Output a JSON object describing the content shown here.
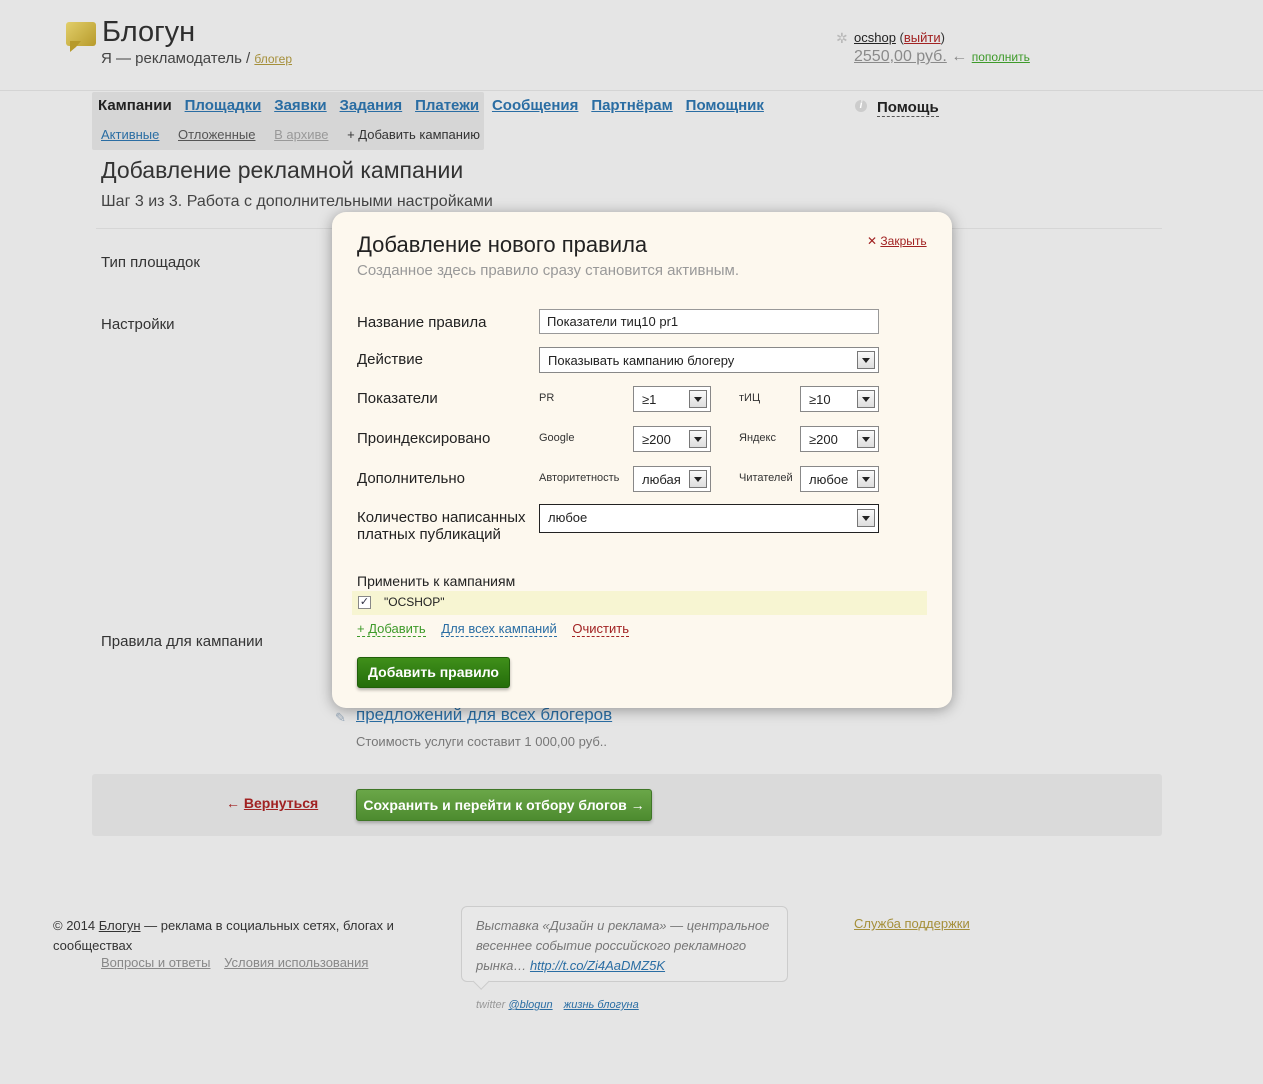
{
  "header": {
    "logo_text": "Блогун",
    "role_prefix": "Я — рекламодатель /",
    "role_link": "блогер",
    "username": "ocshop",
    "logout_label": "выйти",
    "balance": "2550,00 руб.",
    "topup_label": "пополнить"
  },
  "nav": {
    "items": [
      "Кампании",
      "Площадки",
      "Заявки",
      "Задания",
      "Платежи",
      "Сообщения",
      "Партнёрам",
      "Помощник"
    ],
    "sub_items": [
      "Активные",
      "Отложенные",
      "В архиве",
      "+ Добавить кампанию"
    ],
    "help_label": "Помощь"
  },
  "page": {
    "title": "Добавление рекламной кампании",
    "step": "Шаг 3 из 3. Работа с дополнительными настройками",
    "label_site_type": "Тип площадок",
    "label_settings": "Настройки",
    "label_rules": "Правила для кампании",
    "all_bloggers_link": "предложений для всех блогеров",
    "cost_text": "Стоимость услуги составит 1 000,00 руб..",
    "back_label": "Вернуться",
    "save_label": "Сохранить и перейти к отбору блогов →"
  },
  "modal": {
    "title": "Добавление нового правила",
    "subtitle": "Созданное здесь правило сразу становится активным.",
    "close_label": "Закрыть",
    "rule_name_label": "Название правила",
    "rule_name_value": "Показатели тиц10 pr1",
    "action_label": "Действие",
    "action_value": "Показывать кампанию блогеру",
    "metrics_label": "Показатели",
    "pr_label": "PR",
    "pr_value": "≥1",
    "tic_label": "тИЦ",
    "tic_value": "≥10",
    "indexed_label": "Проиндексировано",
    "google_label": "Google",
    "google_value": "≥200",
    "yandex_label": "Яндекс",
    "yandex_value": "≥200",
    "extra_label": "Дополнительно",
    "authority_label": "Авторитетность",
    "authority_value": "любая",
    "readers_label": "Читателей",
    "readers_value": "любое",
    "paid_posts_label": "Количество написанных платных публикаций",
    "paid_posts_value": "любое",
    "apply_label": "Применить к кампаниям",
    "campaign_name": "\"OCSHOP\"",
    "add_label": "+ Добавить",
    "all_campaigns_label": "Для всех кампаний",
    "clear_label": "Очистить",
    "submit_label": "Добавить правило"
  },
  "footer": {
    "copyright_prefix": "© 2014",
    "brand_link": "Блогун",
    "copyright_suffix": "— реклама в социальных сетях, блогах и сообществах",
    "faq_label": "Вопросы и ответы",
    "terms_label": "Условия использования",
    "tweet_text": "Выставка «Дизайн и реклама» — центральное весеннее событие российского рекламного рынка…",
    "tweet_link": "http://t.co/Zi4AaDMZ5K",
    "twitter_prefix": "twitter",
    "twitter_handle": "@blogun",
    "life_label": "жизнь блогуна",
    "support_label": "Служба поддержки"
  }
}
